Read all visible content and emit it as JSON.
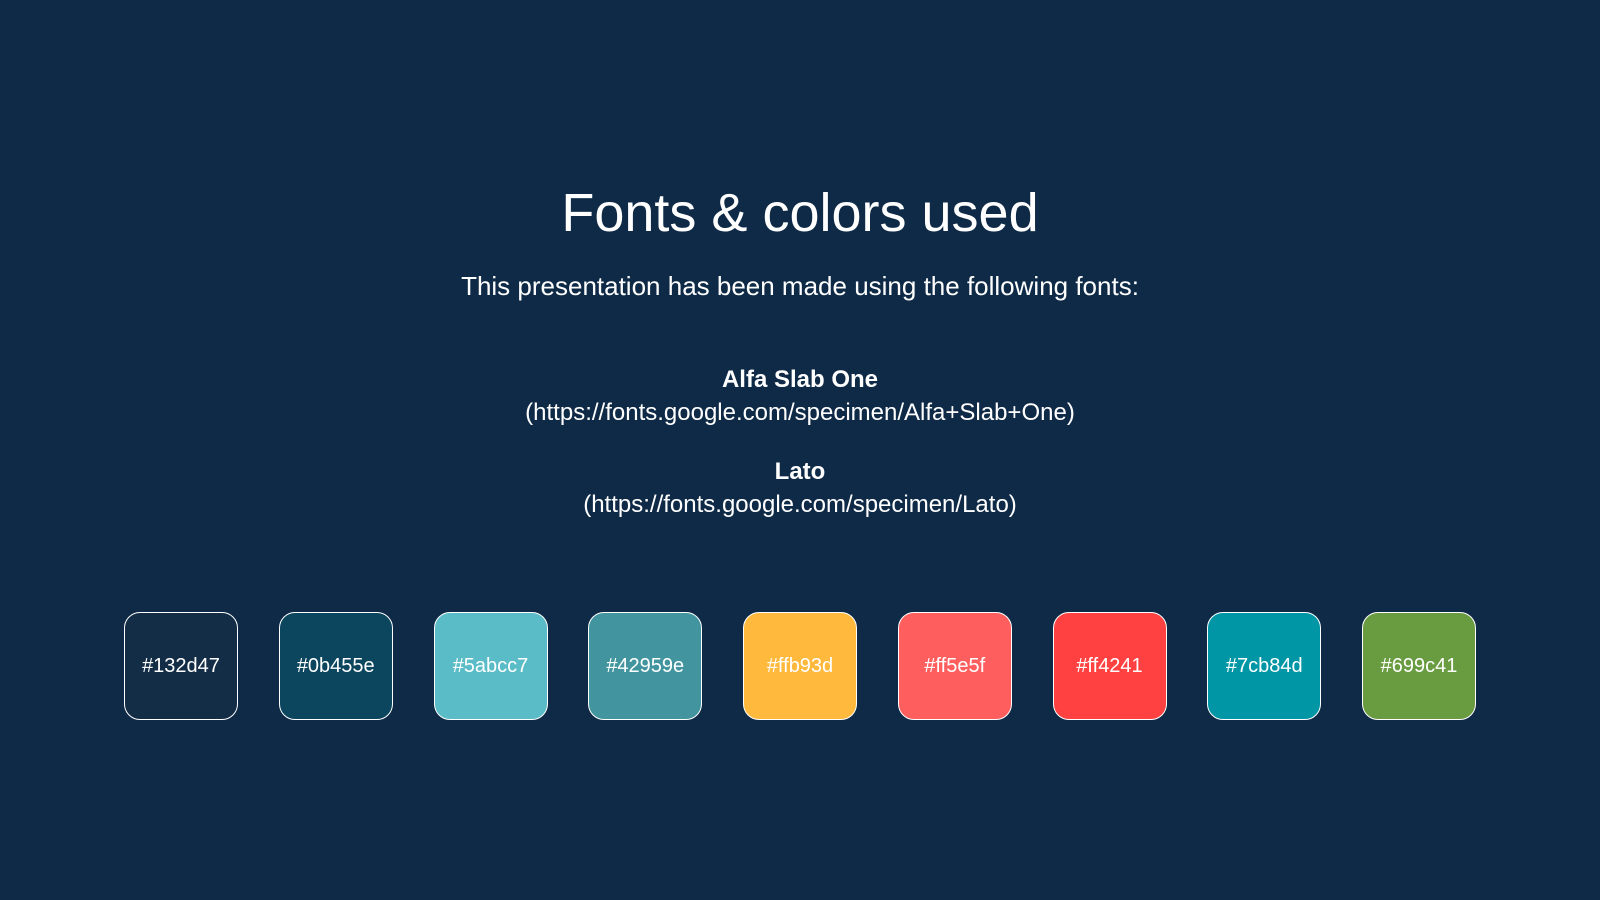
{
  "slide": {
    "title": "Fonts & colors used",
    "subtitle": "This presentation has been made using the following fonts:",
    "fonts": [
      {
        "name": "Alfa Slab One",
        "url": "(https://fonts.google.com/specimen/Alfa+Slab+One)"
      },
      {
        "name": "Lato",
        "url": "(https://fonts.google.com/specimen/Lato)"
      }
    ],
    "swatches": [
      {
        "label": "#132d47",
        "color": "#132d47"
      },
      {
        "label": "#0b455e",
        "color": "#0b455e"
      },
      {
        "label": "#5abcc7",
        "color": "#5abcc7"
      },
      {
        "label": "#42959e",
        "color": "#42959e"
      },
      {
        "label": "#ffb93d",
        "color": "#ffb93d"
      },
      {
        "label": "#ff5e5f",
        "color": "#ff5e5f"
      },
      {
        "label": "#ff4241",
        "color": "#ff4241"
      },
      {
        "label": "#7cb84d",
        "color": "#0096a6"
      },
      {
        "label": "#699c41",
        "color": "#699c41"
      }
    ],
    "background_color": "#0f2a47"
  }
}
